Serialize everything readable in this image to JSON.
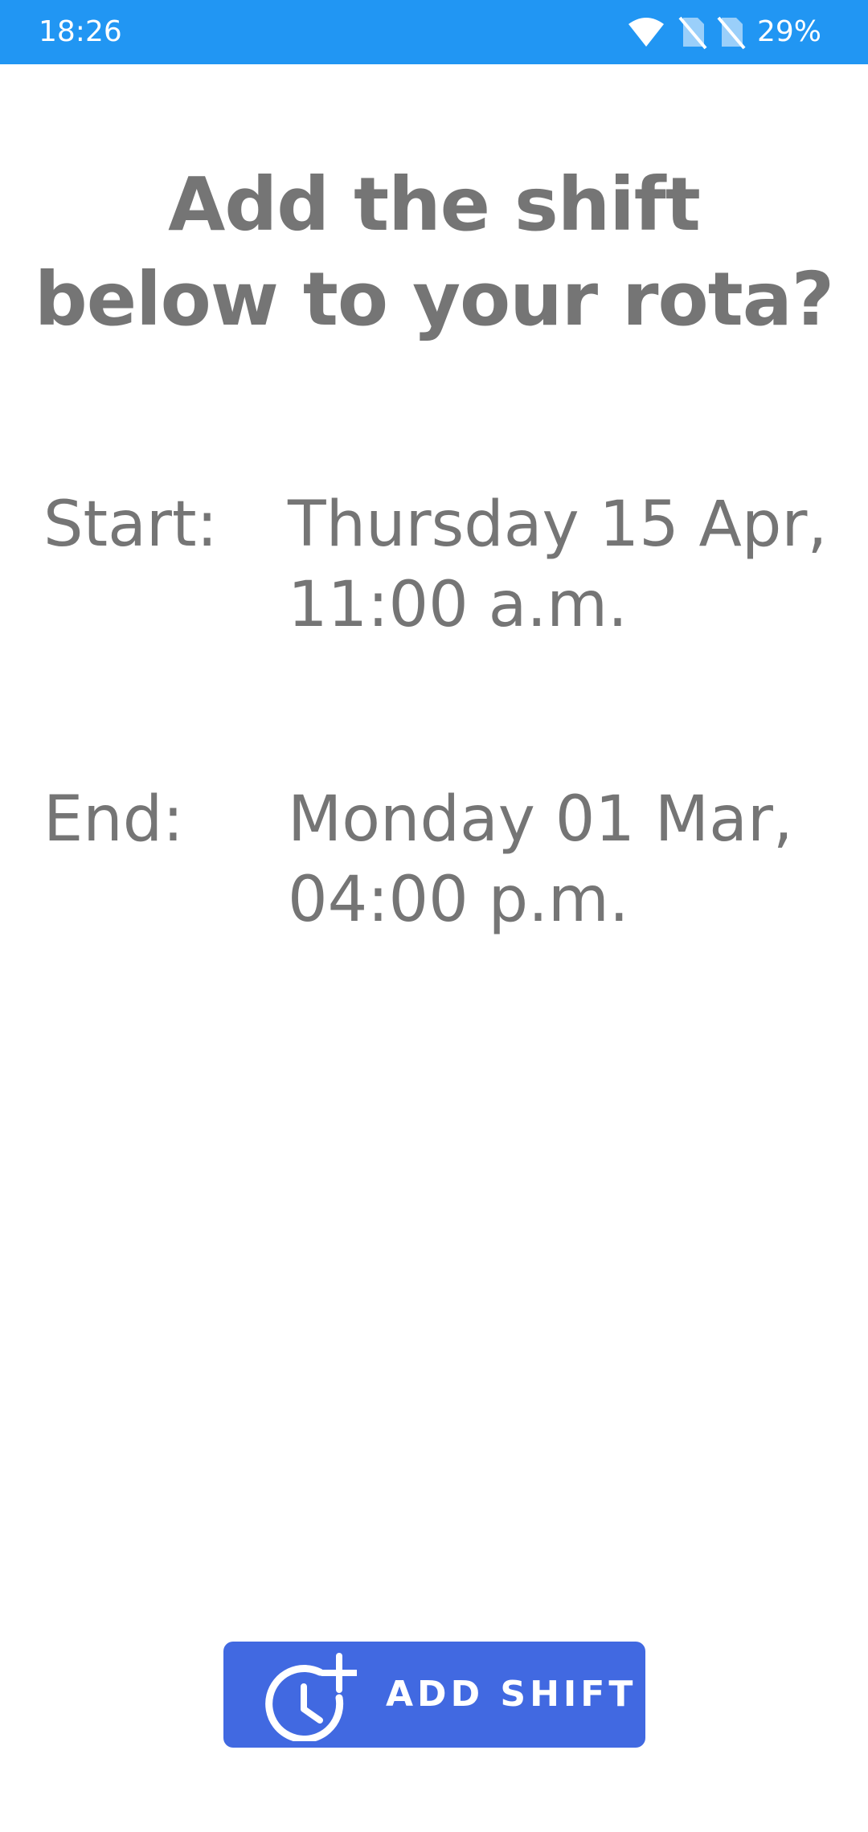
{
  "status_bar": {
    "time": "18:26",
    "battery": "29%",
    "icons": [
      "wifi-icon",
      "no-sim-icon",
      "no-sim-icon",
      "battery-text"
    ],
    "color": "#2196f3"
  },
  "dialog": {
    "title_line1": "Add the shift",
    "title_line2": "below to your rota?",
    "start": {
      "label": "Start:",
      "value_line1": "Thursday 15 Apr,",
      "value_line2": "11:00 a.m."
    },
    "end": {
      "label": "End:",
      "value_line1": "Monday 01 Mar,",
      "value_line2": "04:00 p.m."
    }
  },
  "button": {
    "label": "ADD SHIFT",
    "icon": "clock-plus-icon",
    "color": "#4169e1"
  },
  "text_color": "#757575"
}
